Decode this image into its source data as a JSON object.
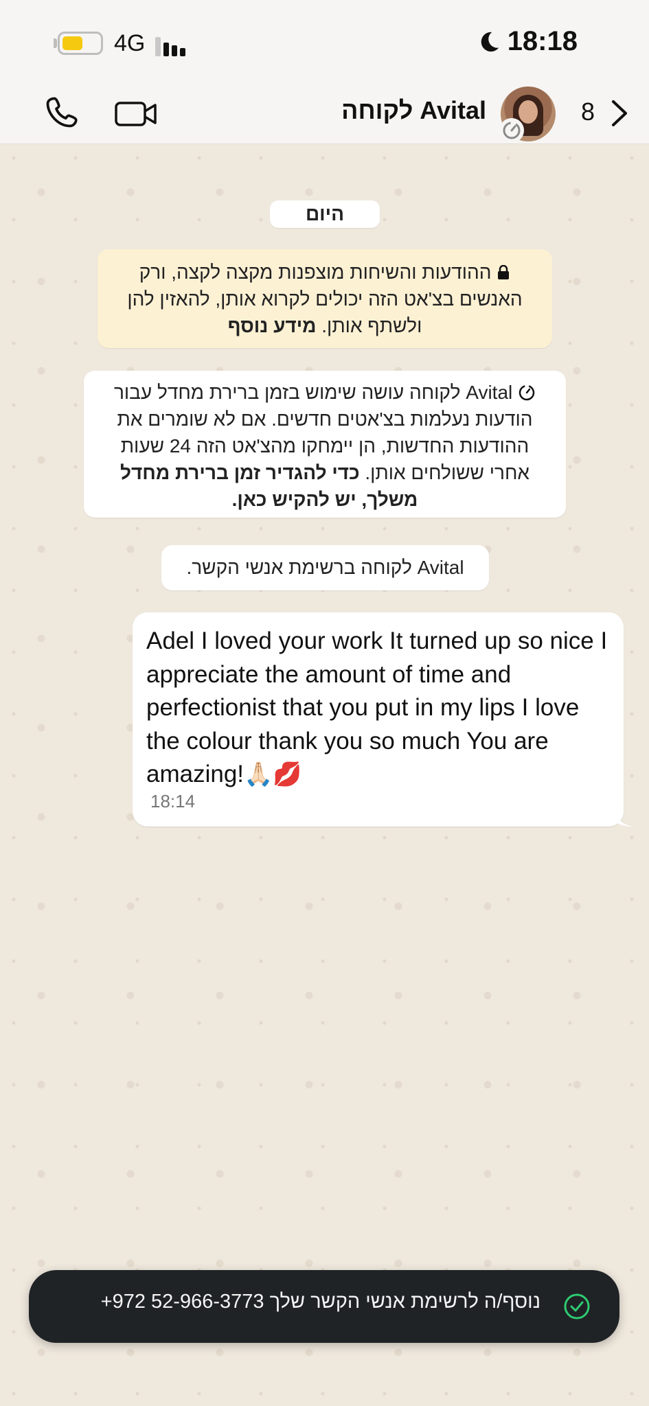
{
  "status_bar": {
    "network": "4G",
    "time": "18:18",
    "battery_level": 0.55,
    "battery_color": "#f5c90f"
  },
  "header": {
    "contact_name": "לקוחה Avital",
    "unread_count": "8",
    "icons": [
      "phone-icon",
      "video-camera-icon",
      "timer-icon",
      "chevron-right-icon"
    ]
  },
  "chat": {
    "date_label": "היום",
    "encryption_notice": {
      "text": "ההודעות והשיחות מוצפנות מקצה לקצה, ורק האנשים בצ'אט הזה יכולים לקרוא אותן, להאזין להן ולשתף אותן.",
      "link": "מידע נוסף"
    },
    "disappearing_notice": {
      "text": "Avital לקוחה עושה שימוש בזמן ברירת מחדל עבור הודעות נעלמות בצ'אטים חדשים. אם לא שומרים את ההודעות החדשות, הן יימחקו מהצ'אט הזה 24 שעות אחרי ששולחים אותן.",
      "bold": "כדי להגדיר זמן ברירת מחדל משלך, יש להקיש כאן."
    },
    "contact_notice": "Avital לקוחה ברשימת אנשי הקשר.",
    "message": {
      "text": "Adel I loved your work It turned up so nice I appreciate the amount of time and perfectionist that you put in my lips I love the colour thank you so much You are amazing!",
      "emojis": "🙏🏻💋",
      "time": "18:14"
    }
  },
  "toast": {
    "text": "+972 52-966-3773 נוסף/ה לרשימת אנשי הקשר שלך",
    "accent": "#2ecc71"
  }
}
